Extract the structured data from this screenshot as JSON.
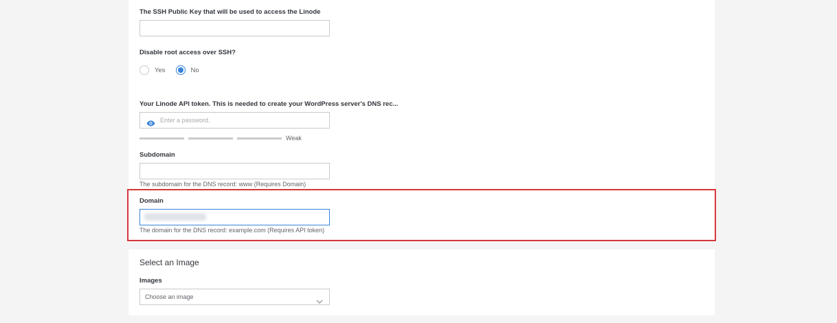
{
  "ssh_key": {
    "label": "The SSH Public Key that will be used to access the Linode",
    "value": ""
  },
  "root_access": {
    "label": "Disable root access over SSH?",
    "options": [
      {
        "label": "Yes",
        "selected": false
      },
      {
        "label": "No",
        "selected": true
      }
    ]
  },
  "api_token": {
    "label": "Your Linode API token. This is needed to create your WordPress server's DNS rec...",
    "placeholder": "Enter a password.",
    "icon": "eye-icon",
    "strength_label": "Weak"
  },
  "subdomain": {
    "label": "Subdomain",
    "value": "",
    "helper": "The subdomain for the DNS record: www (Requires Domain)"
  },
  "domain": {
    "label": "Domain",
    "helper": "The domain for the DNS record: example.com (Requires API token)"
  },
  "image_section": {
    "title": "Select an Image",
    "images_label": "Images",
    "selected_value": "Choose an image",
    "icon": "chevron-down-icon"
  },
  "colors": {
    "accent": "#3683dc",
    "highlight": "#d6373a",
    "background": "#f4f4f4"
  }
}
